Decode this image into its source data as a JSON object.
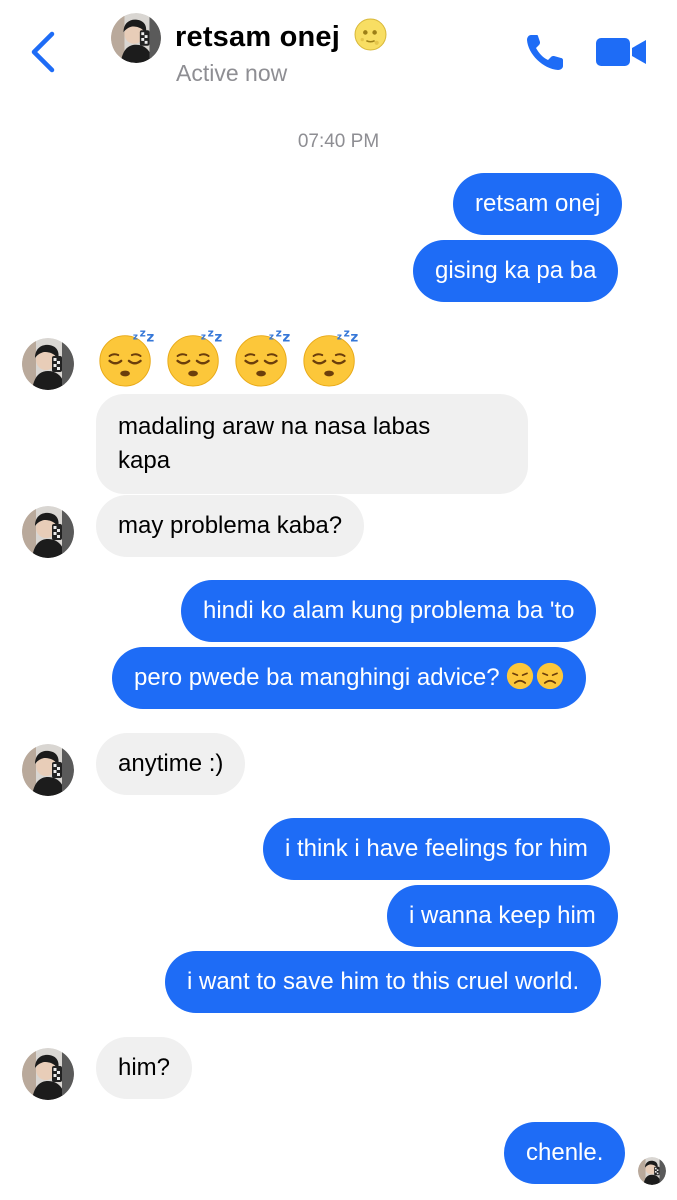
{
  "header": {
    "contact_name": "retsam onej",
    "status": "Active now",
    "name_emoji": "moon-face-icon"
  },
  "conversation": {
    "timestamp": "07:40 PM",
    "messages": [
      {
        "from": "me",
        "text": "retsam onej"
      },
      {
        "from": "me",
        "text": "gising ka pa ba"
      },
      {
        "from": "them",
        "emoji": [
          "sleeping-face-icon",
          "sleeping-face-icon",
          "sleeping-face-icon",
          "sleeping-face-icon"
        ]
      },
      {
        "from": "them",
        "text_line1": "madaling araw na nasa labas",
        "text_line2": "kapa"
      },
      {
        "from": "them",
        "text": "may problema kaba?"
      },
      {
        "from": "me",
        "text": "hindi ko alam kung problema ba 'to"
      },
      {
        "from": "me",
        "text": "pero pwede ba manghingi advice?",
        "emoji": [
          "disappointed-face-icon",
          "disappointed-face-icon"
        ]
      },
      {
        "from": "them",
        "text": "anytime :)"
      },
      {
        "from": "me",
        "text": "i think i have feelings for him"
      },
      {
        "from": "me",
        "text": "i wanna keep him"
      },
      {
        "from": "me",
        "text": "i want to save him to this cruel world."
      },
      {
        "from": "them",
        "text": "him?"
      },
      {
        "from": "me",
        "text": "chenle."
      }
    ]
  },
  "colors": {
    "accent": "#1e6cf6",
    "incoming_bubble": "#f0f0f0",
    "muted_text": "#8e8e93"
  }
}
